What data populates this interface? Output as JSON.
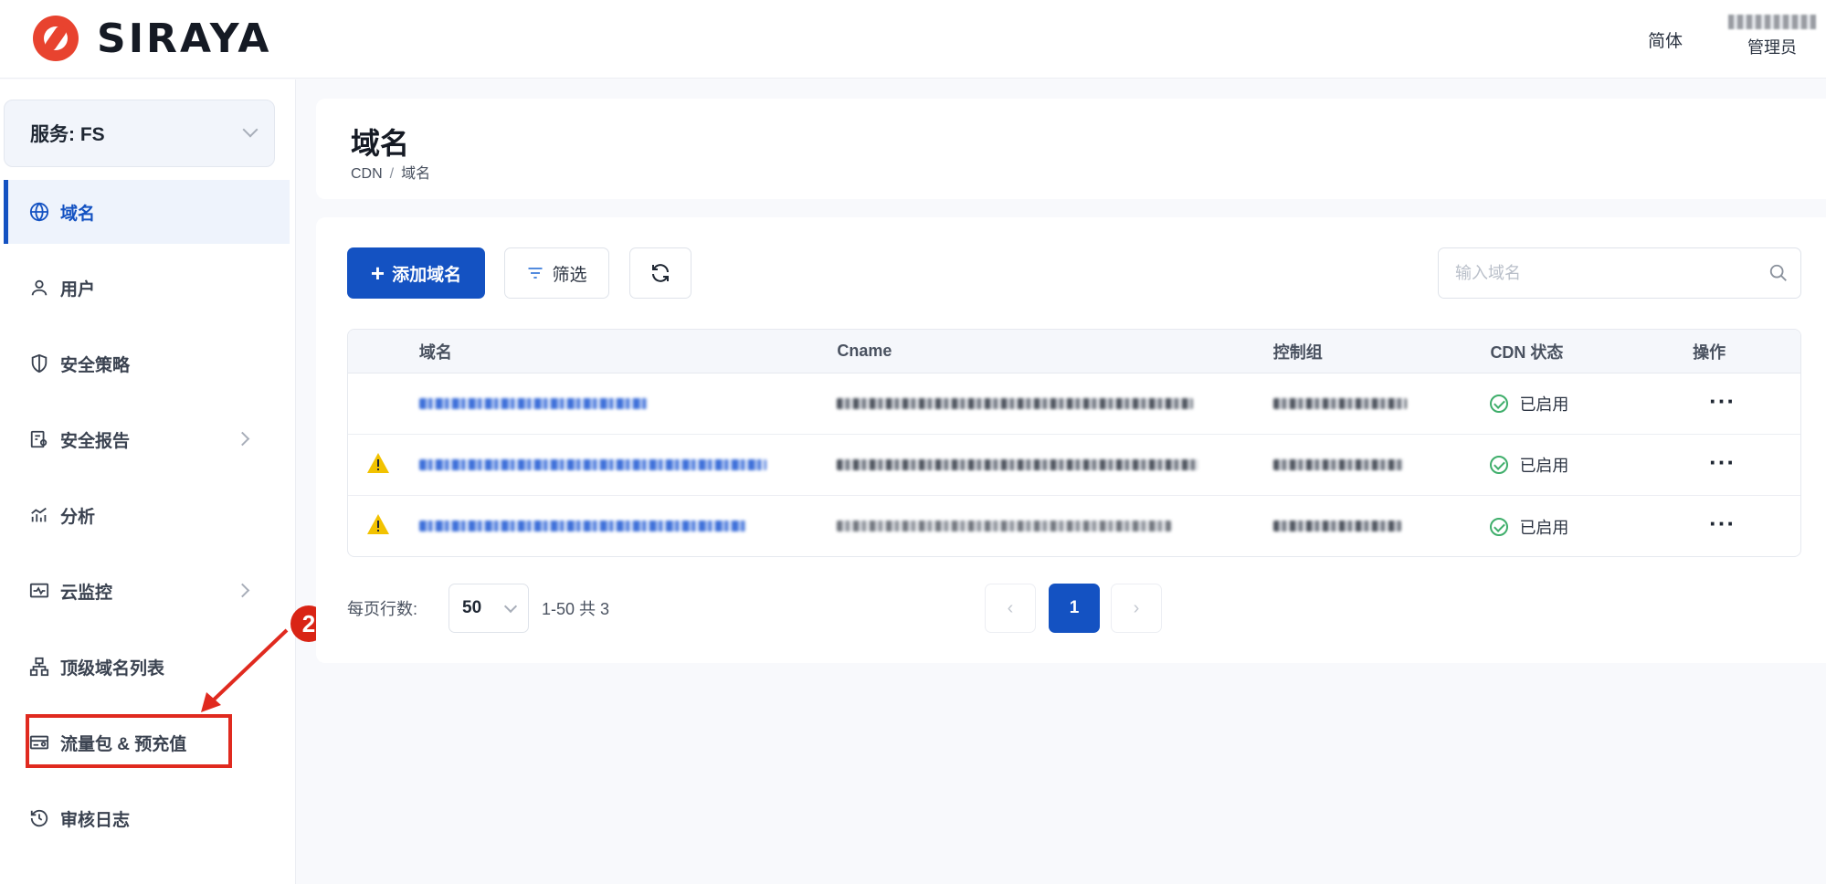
{
  "header": {
    "logo_text": "SIRAYA",
    "lang_label": "简体",
    "user_role": "管理员"
  },
  "sidebar": {
    "service_label": "服务: FS",
    "items": [
      {
        "label": "域名",
        "icon": "globe-icon",
        "active": true
      },
      {
        "label": "用户",
        "icon": "user-icon"
      },
      {
        "label": "安全策略",
        "icon": "shield-icon"
      },
      {
        "label": "安全报告",
        "icon": "report-icon",
        "expandable": true
      },
      {
        "label": "分析",
        "icon": "analytics-icon"
      },
      {
        "label": "云监控",
        "icon": "monitor-icon",
        "expandable": true
      },
      {
        "label": "顶级域名列表",
        "icon": "sitemap-icon"
      },
      {
        "label": "流量包 & 预充值",
        "icon": "card-icon"
      },
      {
        "label": "审核日志",
        "icon": "history-icon"
      }
    ]
  },
  "annotation": {
    "step_number": "2",
    "color": "#e02a1f"
  },
  "page": {
    "title": "域名",
    "breadcrumb": [
      "CDN",
      "域名"
    ],
    "breadcrumb_sep": "/"
  },
  "toolbar": {
    "add_label": "添加域名",
    "filter_label": "筛选",
    "search_placeholder": "输入域名"
  },
  "table": {
    "headers": {
      "domain": "域名",
      "cname": "Cname",
      "group": "控制组",
      "status": "CDN 状态",
      "ops": "操作"
    },
    "rows": [
      {
        "warning": false,
        "status": "已启用"
      },
      {
        "warning": true,
        "status": "已启用"
      },
      {
        "warning": true,
        "status": "已启用"
      }
    ]
  },
  "pagination": {
    "rows_per_page_label": "每页行数:",
    "rows_per_page": "50",
    "range": "1-50 共 3",
    "current_page": "1"
  },
  "colors": {
    "primary": "#1452c2",
    "success": "#3fae6b",
    "warning": "#f2c200",
    "annotation": "#e02a1f"
  }
}
